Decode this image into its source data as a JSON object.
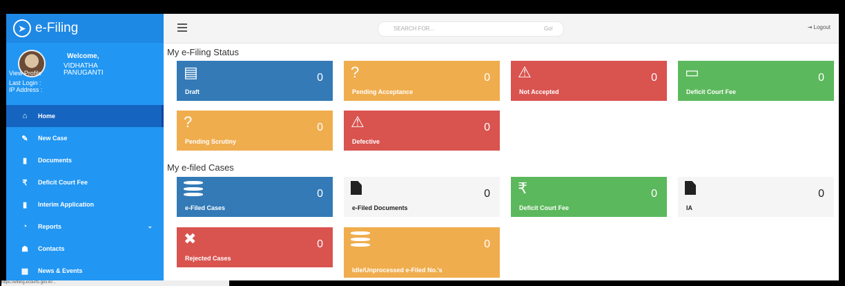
{
  "brand": {
    "title": "e-Filing"
  },
  "user": {
    "welcome": "Welcome,",
    "name": "VIDHATHA PANUGANTI",
    "view_profile": "View Profile",
    "last_login": "Last Login :",
    "ip_address": "IP Address :"
  },
  "sidebar": {
    "items": [
      {
        "label": "Home",
        "icon": "home-icon",
        "glyph": "⌂"
      },
      {
        "label": "New Case",
        "icon": "edit-icon",
        "glyph": "✎"
      },
      {
        "label": "Documents",
        "icon": "file-icon",
        "glyph": "▮"
      },
      {
        "label": "Deficit Court Fee",
        "icon": "rupee-icon",
        "glyph": "₹"
      },
      {
        "label": "Interim Application",
        "icon": "file-icon",
        "glyph": "▮"
      },
      {
        "label": "Reports",
        "icon": "reports-icon",
        "glyph": "◔"
      },
      {
        "label": "Contacts",
        "icon": "users-icon",
        "glyph": "☗"
      },
      {
        "label": "News & Events",
        "icon": "news-icon",
        "glyph": "▦"
      }
    ],
    "reports_chevron": "⌄"
  },
  "topbar": {
    "search_placeholder": "SEARCH FOR...",
    "go_label": "Go!",
    "logout_label": "Logout",
    "logout_glyph": "⇥"
  },
  "status_section": {
    "title": "My e-Filing Status",
    "cards": [
      {
        "label": "Draft",
        "count": "0",
        "glyph": "▤"
      },
      {
        "label": "Pending Acceptance",
        "count": "0",
        "glyph": "?"
      },
      {
        "label": "Not Accepted",
        "count": "0",
        "glyph": "⚠"
      },
      {
        "label": "Deficit Court Fee",
        "count": "0",
        "glyph": "▭"
      },
      {
        "label": "Pending Scrutiny",
        "count": "0",
        "glyph": "?"
      },
      {
        "label": "Defective",
        "count": "0",
        "glyph": "⚠"
      }
    ]
  },
  "cases_section": {
    "title": "My e-filed Cases",
    "cards": [
      {
        "label": "e-Filed Cases",
        "count": "0"
      },
      {
        "label": "e-Filed Documents",
        "count": "0"
      },
      {
        "label": "Deficit Court Fee",
        "count": "0",
        "glyph": "₹"
      },
      {
        "label": "IA",
        "count": "0"
      },
      {
        "label": "Rejected Cases",
        "count": "0",
        "glyph": "✖"
      },
      {
        "label": "Idle/Unprocessed e-Filed No.'s",
        "count": "0"
      }
    ]
  },
  "status_url": "https://efiling.ecourts.gov.in/..."
}
